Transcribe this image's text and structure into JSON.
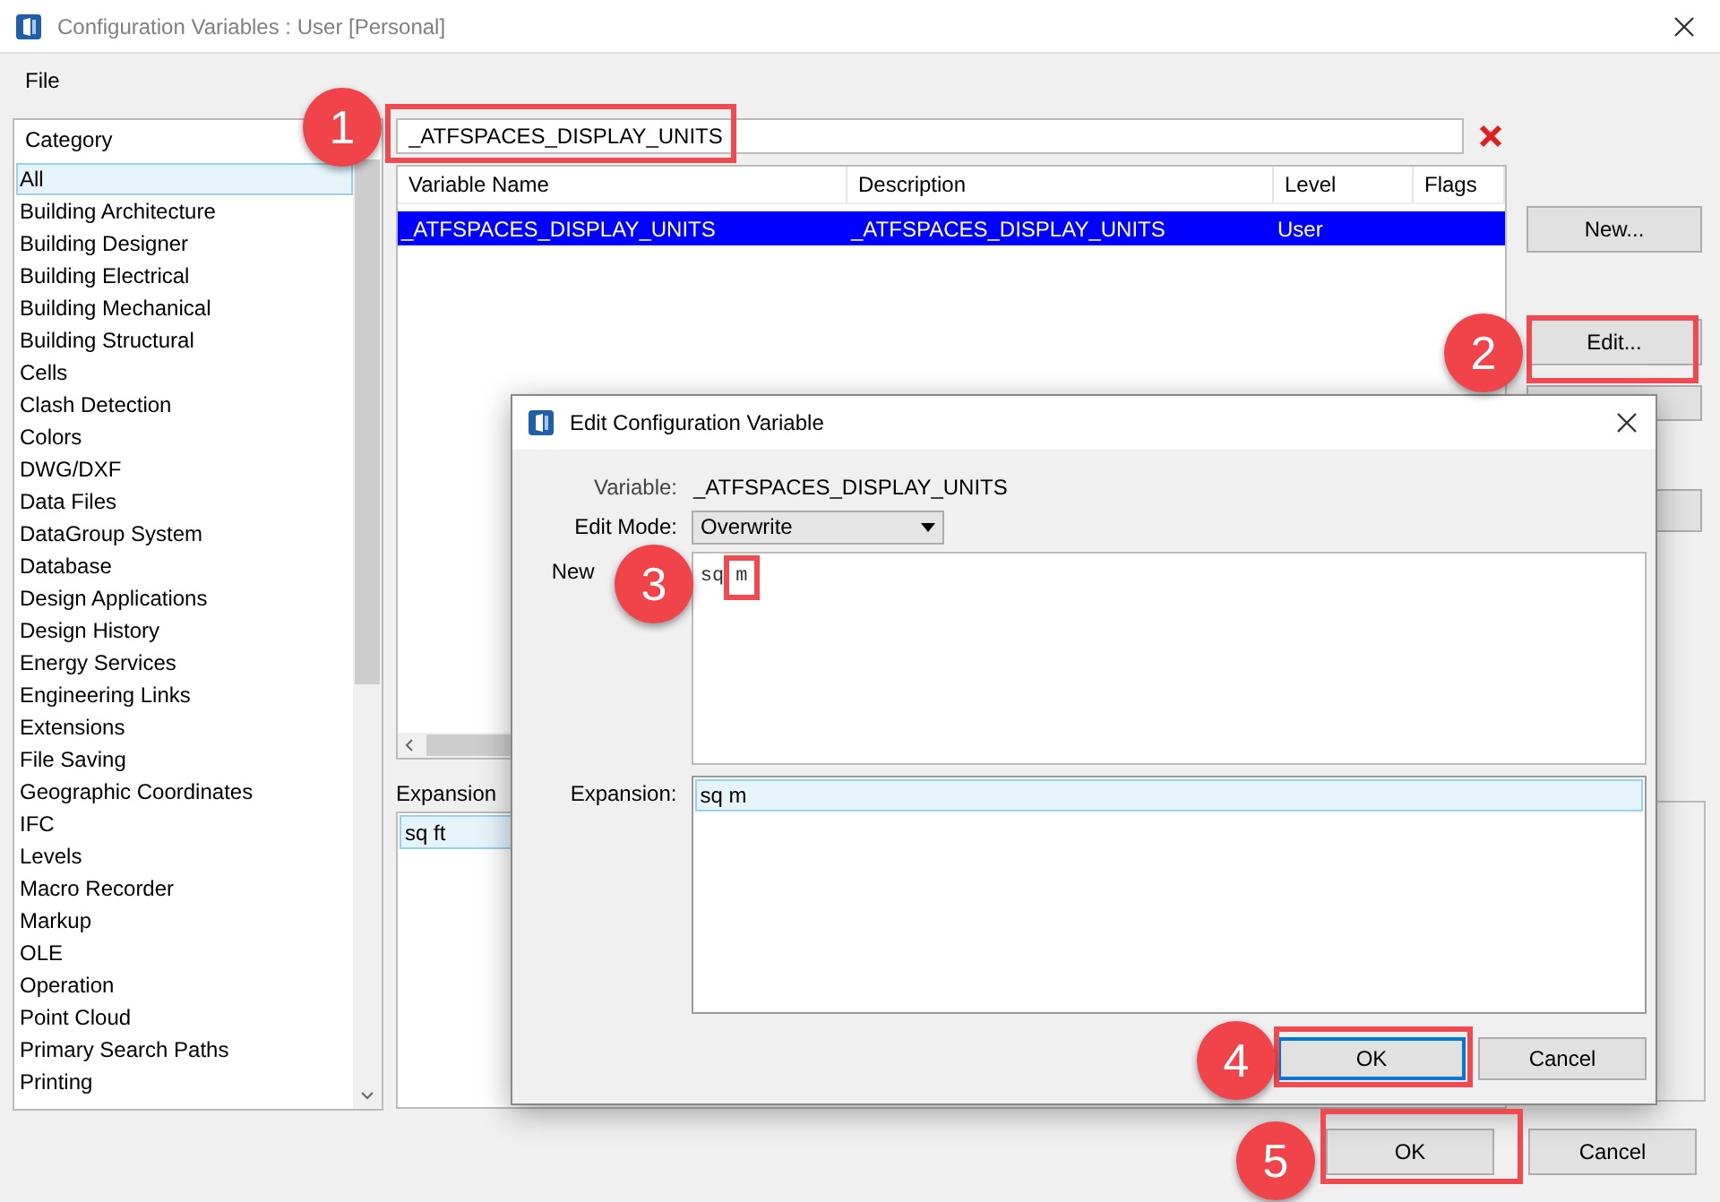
{
  "window": {
    "title": "Configuration Variables : User [Personal]"
  },
  "menu": [
    "File"
  ],
  "category": {
    "header": "Category",
    "items": [
      {
        "label": "All",
        "selected": true
      },
      {
        "label": "Building Architecture",
        "selected": false
      },
      {
        "label": "Building Designer",
        "selected": false
      },
      {
        "label": "Building Electrical",
        "selected": false
      },
      {
        "label": "Building Mechanical",
        "selected": false
      },
      {
        "label": "Building Structural",
        "selected": false
      },
      {
        "label": "Cells",
        "selected": false
      },
      {
        "label": "Clash Detection",
        "selected": false
      },
      {
        "label": "Colors",
        "selected": false
      },
      {
        "label": "DWG/DXF",
        "selected": false
      },
      {
        "label": "Data Files",
        "selected": false
      },
      {
        "label": "DataGroup System",
        "selected": false
      },
      {
        "label": "Database",
        "selected": false
      },
      {
        "label": "Design Applications",
        "selected": false
      },
      {
        "label": "Design History",
        "selected": false
      },
      {
        "label": "Energy Services",
        "selected": false
      },
      {
        "label": "Engineering Links",
        "selected": false
      },
      {
        "label": "Extensions",
        "selected": false
      },
      {
        "label": "File Saving",
        "selected": false
      },
      {
        "label": "Geographic Coordinates",
        "selected": false
      },
      {
        "label": "IFC",
        "selected": false
      },
      {
        "label": "Levels",
        "selected": false
      },
      {
        "label": "Macro Recorder",
        "selected": false
      },
      {
        "label": "Markup",
        "selected": false
      },
      {
        "label": "OLE",
        "selected": false
      },
      {
        "label": "Operation",
        "selected": false
      },
      {
        "label": "Point Cloud",
        "selected": false
      },
      {
        "label": "Primary Search Paths",
        "selected": false
      },
      {
        "label": "Printing",
        "selected": false
      }
    ]
  },
  "search": {
    "value": "_ATFSPACES_DISPLAY_UNITS"
  },
  "table": {
    "columns": [
      "Variable Name",
      "Description",
      "Level",
      "Flags"
    ],
    "rows": [
      {
        "cells": [
          "_ATFSPACES_DISPLAY_UNITS",
          "_ATFSPACES_DISPLAY_UNITS",
          "User",
          ""
        ],
        "selected": true
      }
    ]
  },
  "expansion": {
    "label": "Expansion",
    "items": [
      {
        "label": "sq ft",
        "selected": true
      }
    ]
  },
  "side_buttons": [
    "New...",
    "Edit..."
  ],
  "buttons": [
    "OK",
    "Cancel"
  ],
  "dialog": {
    "title": "Edit Configuration Variable",
    "variable_label": "Variable:",
    "variable_value": "_ATFSPACES_DISPLAY_UNITS",
    "mode_label": "Edit Mode:",
    "mode_value": "Overwrite",
    "new_label": "New",
    "new_value": "sq m",
    "expansion_label": "Expansion:",
    "expansion_items": [
      {
        "label": "sq m",
        "selected": true
      }
    ],
    "buttons": [
      "OK",
      "Cancel"
    ]
  },
  "callouts": [
    "1",
    "2",
    "3",
    "4",
    "5"
  ]
}
